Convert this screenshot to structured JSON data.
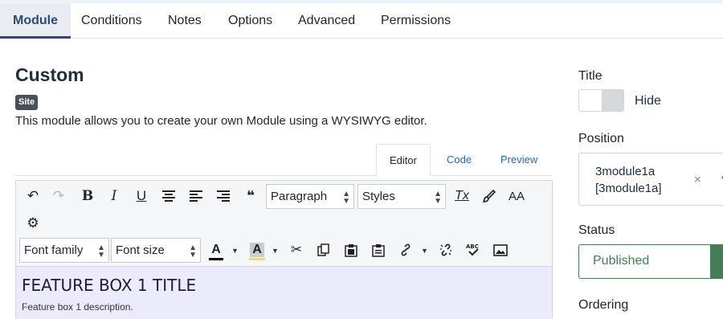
{
  "tabs": [
    "Module",
    "Conditions",
    "Notes",
    "Options",
    "Advanced",
    "Permissions"
  ],
  "page": {
    "title": "Custom",
    "badge": "Site",
    "description": "This module allows you to create your own Module using a WYSIWYG editor."
  },
  "editor_tabs": [
    "Editor",
    "Code",
    "Preview"
  ],
  "toolbar": {
    "paragraph": "Paragraph",
    "styles": "Styles",
    "font_family": "Font family",
    "font_size": "Font size",
    "text_color_label": "A",
    "bg_color_label": "A",
    "text_color": "#000000",
    "bg_color": "#f1e33b",
    "undo": "↶",
    "redo": "↷",
    "bold": "B",
    "italic": "I",
    "underline": "U",
    "blockquote": "❝",
    "clear_format": "Tx",
    "font_icon": "AA",
    "settings": "⚙"
  },
  "content": {
    "heading": "FEATURE BOX 1 TITLE",
    "paragraph": "Feature box 1 description."
  },
  "sidebar": {
    "title_label": "Title",
    "hide_label": "Hide",
    "position_label": "Position",
    "position_value_line1": "3module1a",
    "position_value_line2": "[3module1a]",
    "position_clear": "×",
    "position_dropdown": "▼",
    "status_label": "Status",
    "status_value": "Published",
    "ordering_label": "Ordering"
  },
  "colors": {
    "accent": "#2a4b74",
    "link": "#2a69b8",
    "published": "#457d54",
    "editor_content_bg": "#ecebfb"
  }
}
